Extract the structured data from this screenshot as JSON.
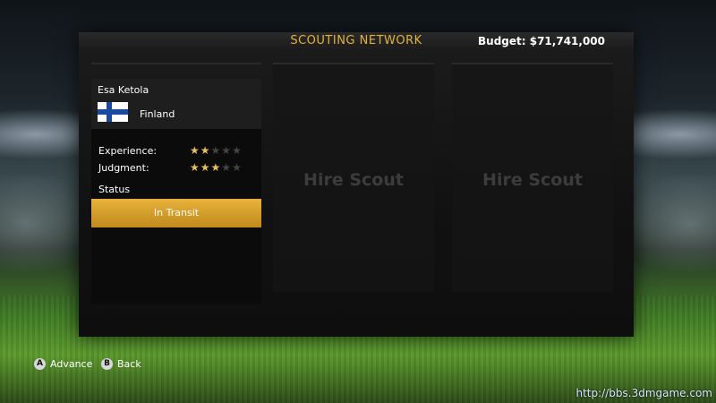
{
  "header": {
    "title": "SCOUTING NETWORK",
    "budget": "Budget: $71,741,000"
  },
  "scout": {
    "name": "Esa Ketola",
    "country": "Finland",
    "flag_icon": "finland-flag-icon",
    "experience_label": "Experience:",
    "experience_stars": 2,
    "judgment_label": "Judgment:",
    "judgment_stars": 3,
    "max_stars": 5,
    "status_label": "Status",
    "status_value": "In Transit"
  },
  "slots": [
    {
      "label": "Hire Scout"
    },
    {
      "label": "Hire Scout"
    }
  ],
  "footer": {
    "advance_glyph": "A",
    "advance_label": "Advance",
    "back_glyph": "B",
    "back_label": "Back"
  },
  "watermark": "http://bbs.3dmgame.com",
  "colors": {
    "accent": "#e3b23c",
    "status_button": "#d9a02c",
    "star_on": "#e8c060",
    "star_off": "#444444"
  }
}
